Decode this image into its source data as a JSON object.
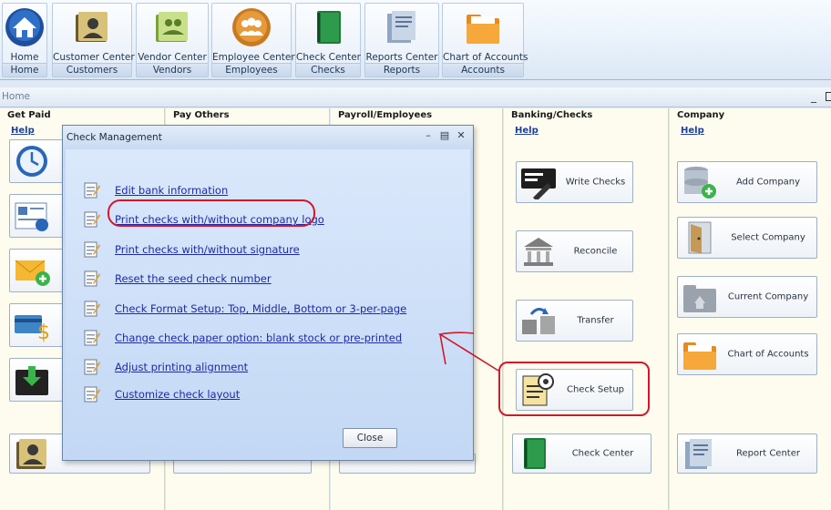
{
  "ribbon": [
    {
      "label": "Home",
      "group": "Home",
      "icon": "home-icon"
    },
    {
      "label": "Customer Center",
      "group": "Customers",
      "icon": "customer-folder-icon"
    },
    {
      "label": "Vendor Center",
      "group": "Vendors",
      "icon": "vendor-folder-icon"
    },
    {
      "label": "Employee Center",
      "group": "Employees",
      "icon": "employees-icon"
    },
    {
      "label": "Check Center",
      "group": "Checks",
      "icon": "check-book-icon"
    },
    {
      "label": "Reports Center",
      "group": "Reports",
      "icon": "reports-icon"
    },
    {
      "label": "Chart of Accounts",
      "group": "Accounts",
      "icon": "accounts-folder-icon"
    }
  ],
  "home_bar": {
    "label": "Home",
    "minimize": "_"
  },
  "columns": {
    "get_paid": {
      "header": "Get Paid",
      "help": "Help"
    },
    "pay_others": {
      "header": "Pay Others"
    },
    "payroll": {
      "header": "Payroll/Employees"
    },
    "banking": {
      "header": "Banking/Checks",
      "help": "Help",
      "tiles": [
        "Write Checks",
        "Reconcile",
        "Transfer",
        "Check Setup",
        "Check Center"
      ]
    },
    "company": {
      "header": "Company",
      "help": "Help",
      "tiles": [
        "Add Company",
        "Select Company",
        "Current Company",
        "Chart of Accounts",
        "Report Center"
      ]
    }
  },
  "dialog": {
    "title": "Check Management",
    "options": [
      "Edit bank information",
      "Print checks with/without company logo",
      "Print checks with/without signature",
      "Reset the seed check number",
      "Check Format Setup: Top, Middle, Bottom or 3-per-page",
      "Change check paper option: blank stock or pre-printed",
      "Adjust printing alignment",
      "Customize check layout"
    ],
    "close_label": "Close"
  },
  "colors": {
    "annotation": "#d1182b",
    "link": "#1d2aa6",
    "column_bg": "#fdfcee",
    "dialog_bg": "#c6d9f3"
  }
}
